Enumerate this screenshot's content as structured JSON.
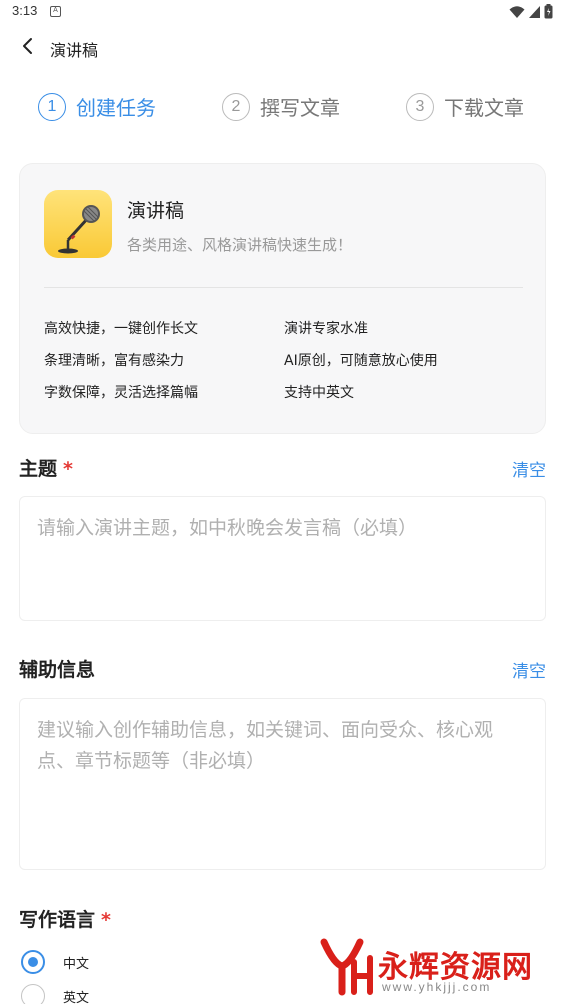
{
  "status_bar": {
    "time": "3:13",
    "notification_glyph": "A"
  },
  "nav": {
    "title": "演讲稿"
  },
  "steps": [
    {
      "number": "1",
      "label": "创建任务",
      "active": true
    },
    {
      "number": "2",
      "label": "撰写文章",
      "active": false
    },
    {
      "number": "3",
      "label": "下载文章",
      "active": false
    }
  ],
  "card": {
    "title": "演讲稿",
    "subtitle": "各类用途、风格演讲稿快速生成！",
    "icon": "microphone-icon",
    "features": [
      "高效快捷，一键创作长文",
      "演讲专家水准",
      "条理清晰，富有感染力",
      "AI原创，可随意放心使用",
      "字数保障，灵活选择篇幅",
      "支持中英文"
    ]
  },
  "topic": {
    "label": "主题",
    "required_mark": "*",
    "clear_label": "清空",
    "value": "",
    "placeholder": "请输入演讲主题，如中秋晚会发言稿（必填）"
  },
  "aux_info": {
    "label": "辅助信息",
    "clear_label": "清空",
    "value": "",
    "placeholder": "建议输入创作辅助信息，如关键词、面向受众、核心观点、章节标题等（非必填）"
  },
  "language": {
    "label": "写作语言",
    "required_mark": "*",
    "options": [
      {
        "label": "中文",
        "selected": true
      },
      {
        "label": "英文",
        "selected": false
      }
    ]
  },
  "watermark": {
    "text": "永辉资源网",
    "url": "www.yhkjjj.com"
  },
  "colors": {
    "accent": "#3a8ee6",
    "required": "#e53935",
    "watermark": "#d9201a"
  }
}
